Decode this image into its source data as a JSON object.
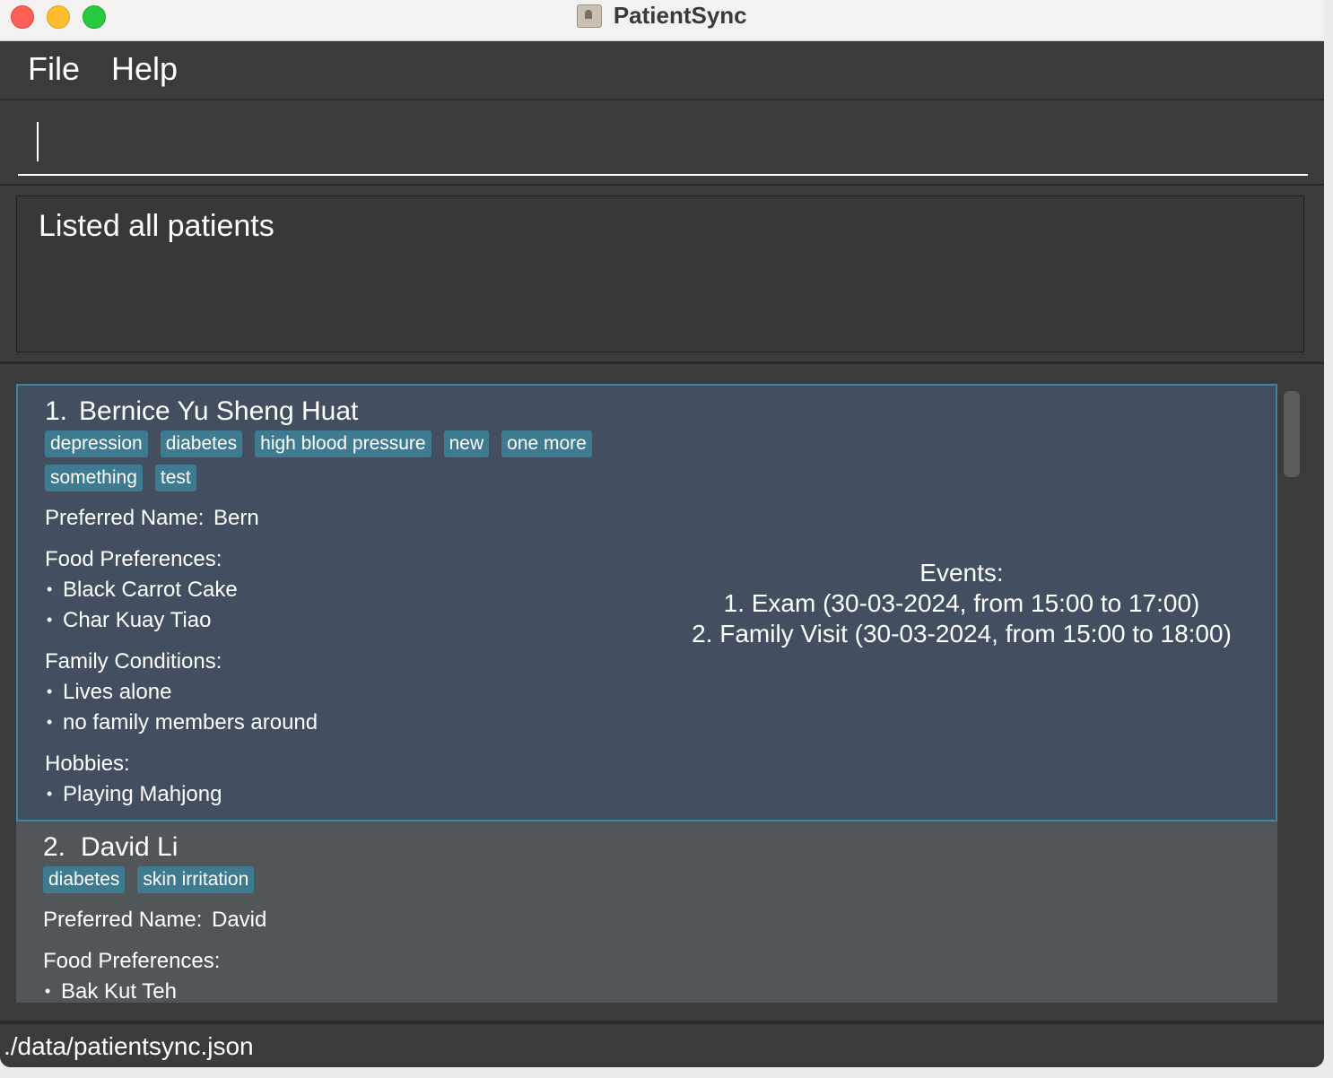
{
  "window": {
    "title": "PatientSync"
  },
  "menubar": {
    "items": [
      "File",
      "Help"
    ]
  },
  "command": {
    "value": "",
    "placeholder": ""
  },
  "result": {
    "message": "Listed all patients"
  },
  "patients": [
    {
      "index": "1.",
      "name": "Bernice Yu Sheng Huat",
      "tags": [
        "depression",
        "diabetes",
        "high blood pressure",
        "new",
        "one more",
        "something",
        "test"
      ],
      "preferred_name_label": "Preferred Name:",
      "preferred_name": "Bern",
      "food_label": "Food Preferences:",
      "food": [
        "Black Carrot Cake",
        "Char Kuay Tiao"
      ],
      "family_label": "Family Conditions:",
      "family": [
        "Lives alone",
        "no family members around"
      ],
      "hobbies_label": "Hobbies:",
      "hobbies": [
        "Playing Mahjong"
      ],
      "events_label": "Events:",
      "events": [
        "1. Exam (30-03-2024, from 15:00 to 17:00)",
        "2. Family Visit (30-03-2024, from 15:00 to 18:00)"
      ]
    },
    {
      "index": "2.",
      "name": "David Li",
      "tags": [
        "diabetes",
        "skin irritation"
      ],
      "preferred_name_label": "Preferred Name:",
      "preferred_name": "David",
      "food_label": "Food Preferences:",
      "food": [
        "Bak Kut Teh"
      ]
    }
  ],
  "status": {
    "file_path": "./data/patientsync.json"
  },
  "colors": {
    "background": "#3b3b3b",
    "selected_card": "#434f60",
    "selected_border": "#3c85a6",
    "card": "#515658",
    "tag": "#3e7b91"
  }
}
